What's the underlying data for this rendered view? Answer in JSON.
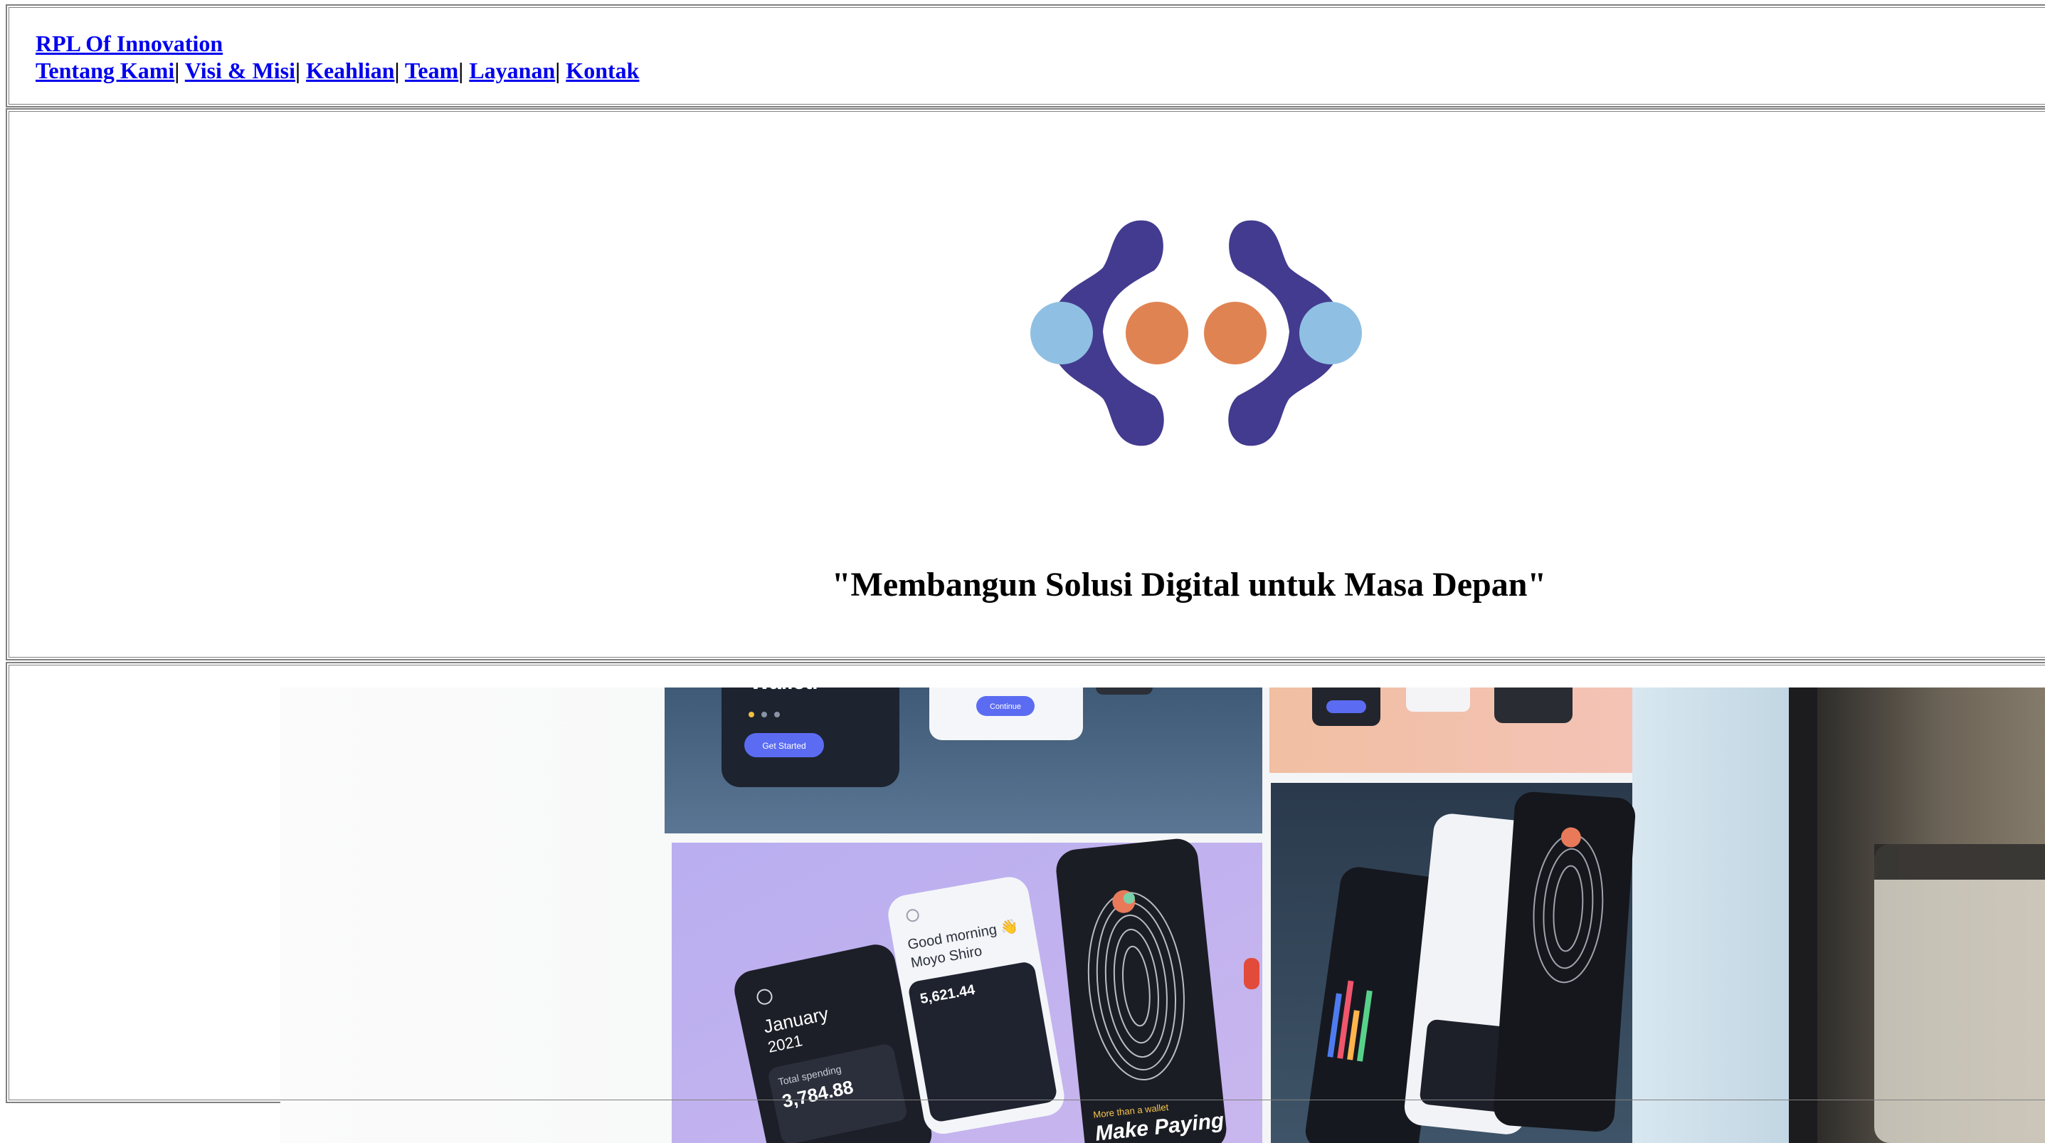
{
  "header": {
    "brand": "RPL Of Innovation",
    "nav": [
      {
        "label": "Tentang Kami"
      },
      {
        "label": "Visi & Misi"
      },
      {
        "label": "Keahlian"
      },
      {
        "label": "Team"
      },
      {
        "label": "Layanan"
      },
      {
        "label": "Kontak"
      }
    ],
    "separator": "|"
  },
  "hero": {
    "logo_icon": "rpl-logo-icon",
    "tagline": "\"Membangun Solusi Digital untuk Masa Depan\""
  },
  "photo": {
    "icon": "app-designs-monitor-photo",
    "texts": {
      "wallet_heading": "Wallet.",
      "get_started": "Get Started",
      "continue": "Continue",
      "month": "January",
      "year": "2021",
      "total_spending_label": "Total spending",
      "total_spending_value": "3,784.88",
      "greeting": "Good morning 👋",
      "user_name": "Moyo Shiro",
      "balance": "5,621.44",
      "promo_line": "More than a wallet",
      "promo_heading": "Make Paying"
    }
  },
  "colors": {
    "link": "#0000ee",
    "logo_purple": "#433b8f",
    "logo_orange": "#e08352",
    "logo_light_blue": "#8fc0e3"
  }
}
